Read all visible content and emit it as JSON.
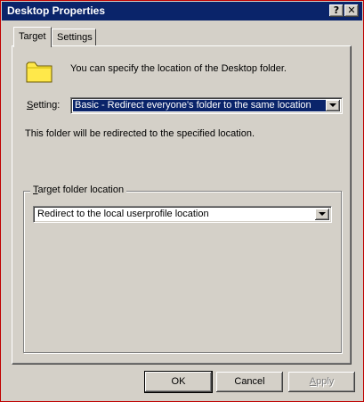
{
  "window": {
    "title": "Desktop Properties"
  },
  "titlebar": {
    "help_glyph": "?",
    "close_glyph": "✕"
  },
  "tabs": [
    {
      "label": "Target",
      "active": true
    },
    {
      "label": "Settings",
      "active": false
    }
  ],
  "info": {
    "text": "You can specify the location of the Desktop folder."
  },
  "setting": {
    "label_underlined": "S",
    "label_rest": "etting:",
    "value": "Basic - Redirect everyone's folder to the same location"
  },
  "description": "This folder will be redirected to the specified location.",
  "target_group": {
    "label_underlined": "T",
    "label_rest": "arget folder location",
    "value": "Redirect to the local userprofile location"
  },
  "buttons": {
    "ok": "OK",
    "cancel": "Cancel",
    "apply_underlined": "A",
    "apply_rest": "pply"
  },
  "colors": {
    "titlebar": "#0a246a",
    "face": "#d4d0c8",
    "folder": "#ffe84a",
    "window_border": "#c00000"
  },
  "icons": {
    "folder": "folder-icon"
  }
}
